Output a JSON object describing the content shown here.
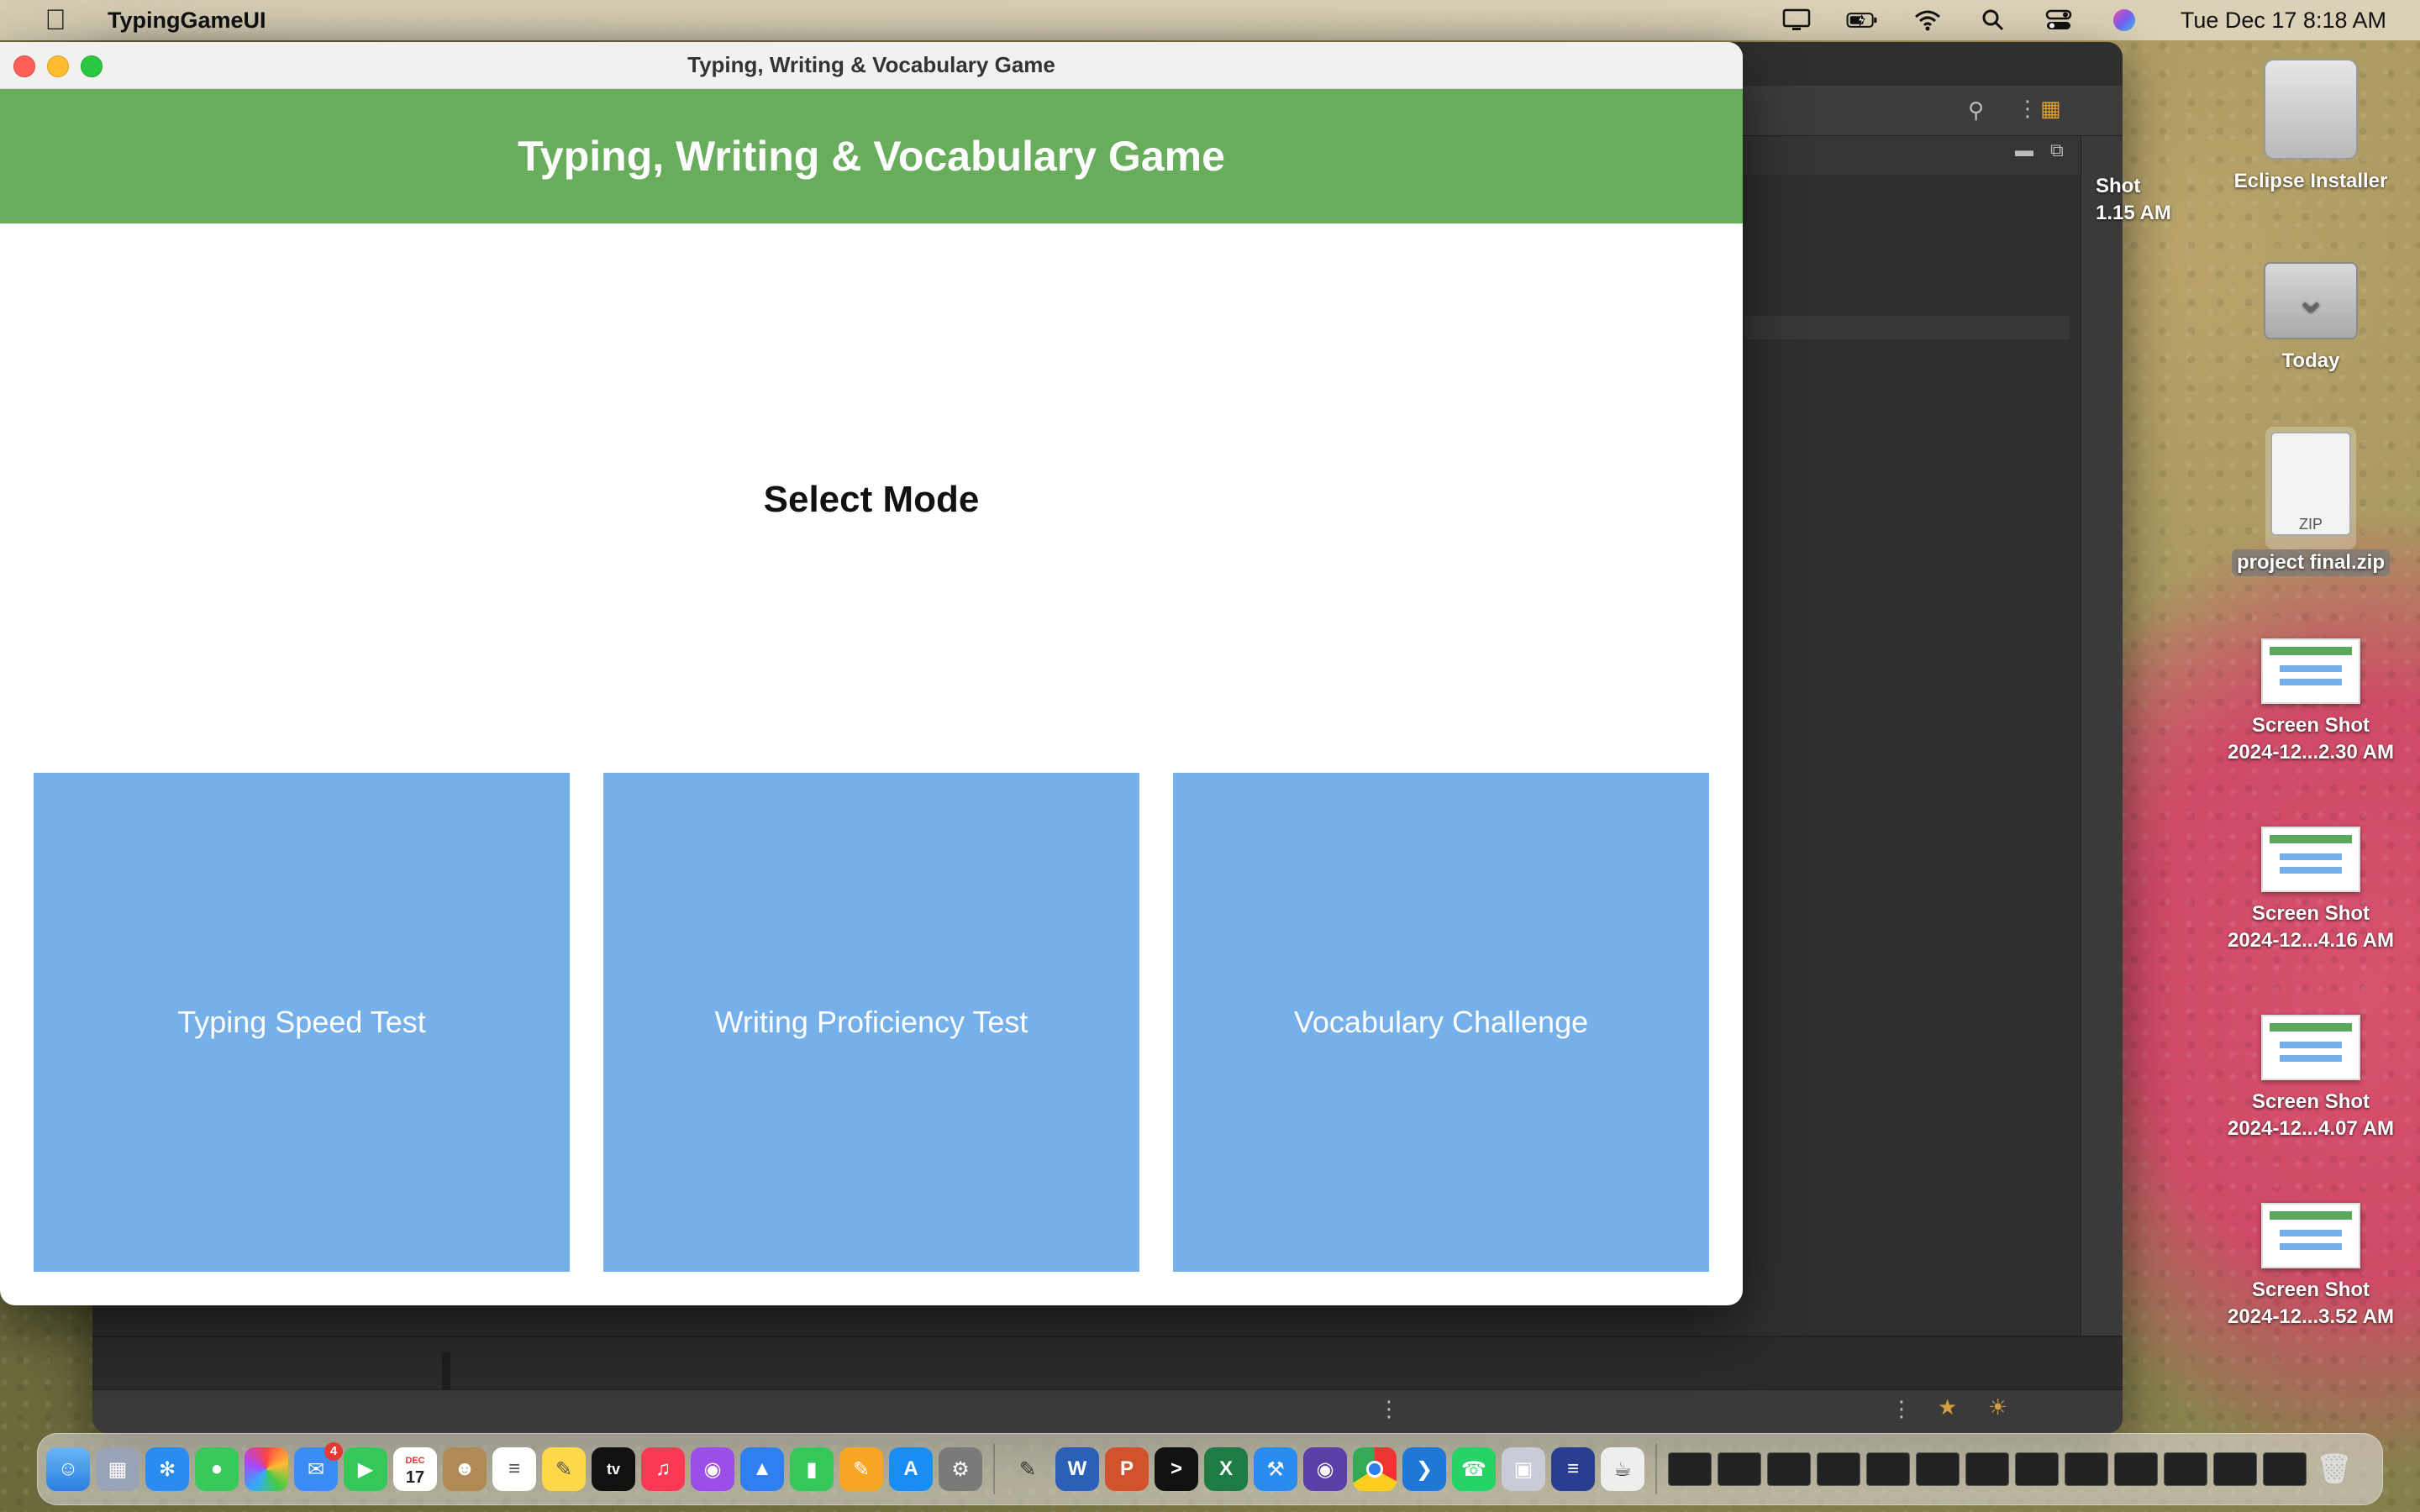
{
  "menubar": {
    "app_name": "TypingGameUI",
    "clock": "Tue Dec 17  8:18 AM",
    "icons": [
      "display-icon",
      "battery-icon",
      "wifi-icon",
      "spotlight-icon",
      "control-center-icon",
      "siri-icon"
    ]
  },
  "window": {
    "title": "Typing, Writing & Vocabulary Game",
    "header_title": "Typing, Writing & Vocabulary Game",
    "prompt": "Select Mode",
    "modes": [
      {
        "label": "Typing Speed Test"
      },
      {
        "label": "Writing Proficiency Test"
      },
      {
        "label": "Vocabulary Challenge"
      }
    ],
    "colors": {
      "header": "#67ad5b",
      "mode_button": "#76b0ea"
    }
  },
  "desktop": {
    "partial_item": {
      "line1": "Shot",
      "line2": "1.15 AM"
    },
    "items": [
      {
        "line1": "Eclipse Installer",
        "line2": ""
      },
      {
        "line1": "Today",
        "line2": ""
      },
      {
        "line1": "project final.zip",
        "line2": "",
        "badge": "ZIP"
      },
      {
        "line1": "Screen Shot",
        "line2": "2024-12...2.30 AM"
      },
      {
        "line1": "Screen Shot",
        "line2": "2024-12...4.16 AM"
      },
      {
        "line1": "Screen Shot",
        "line2": "2024-12...4.07 AM"
      },
      {
        "line1": "Screen Shot",
        "line2": "2024-12...3.52 AM"
      }
    ]
  },
  "dock": {
    "mail_badge": "4",
    "calendar_month": "DEC",
    "calendar_day": "17",
    "tv_label": "tv"
  }
}
